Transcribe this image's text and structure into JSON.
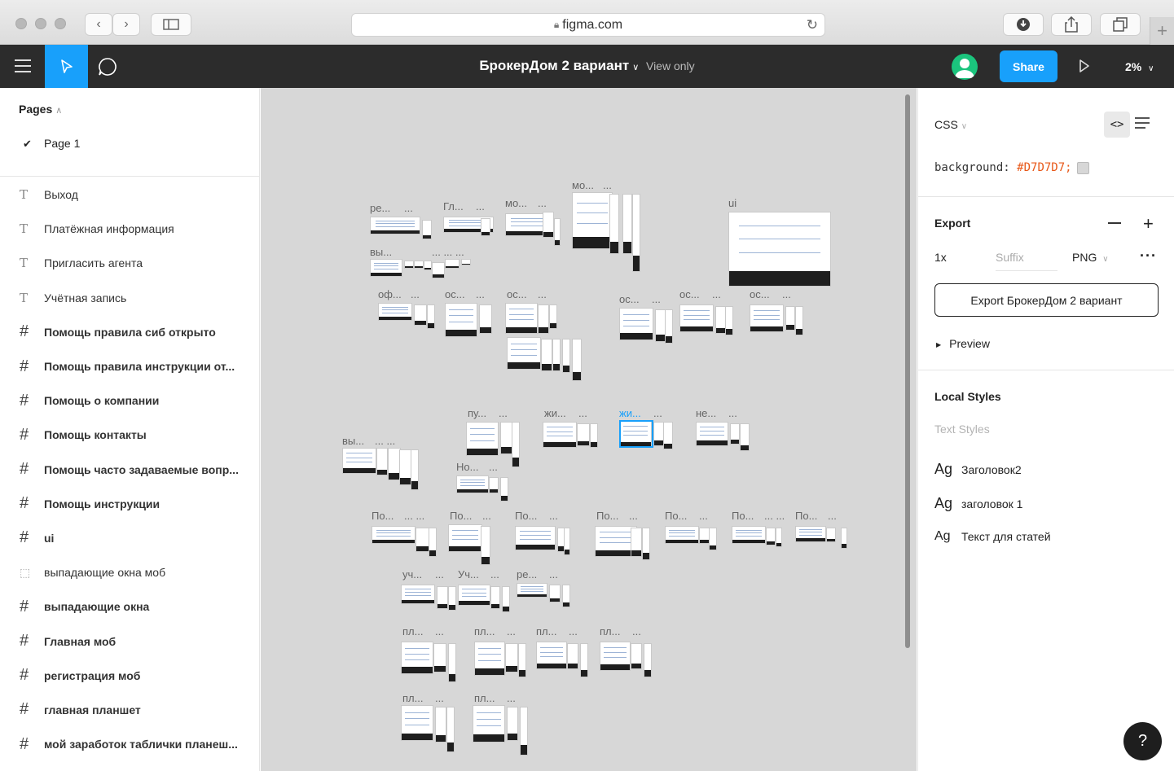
{
  "browser": {
    "url": "figma.com"
  },
  "toolbar": {
    "file_name": "БрокерДом 2 вариант",
    "view_mode": "View only",
    "share_label": "Share",
    "zoom": "2%"
  },
  "pages": {
    "heading": "Pages",
    "current": "Page 1"
  },
  "layers": [
    {
      "icon": "text-icon",
      "name": "Выход"
    },
    {
      "icon": "text-icon",
      "name": "Платёжная информация"
    },
    {
      "icon": "text-icon",
      "name": "Пригласить агента"
    },
    {
      "icon": "text-icon",
      "name": "Учётная запись"
    },
    {
      "icon": "frame-icon",
      "name": "Помощь правила сиб открыто"
    },
    {
      "icon": "frame-icon",
      "name": "Помощь правила инструкции от..."
    },
    {
      "icon": "frame-icon",
      "name": "Помощь о компании"
    },
    {
      "icon": "frame-icon",
      "name": "Помощь контакты"
    },
    {
      "icon": "frame-icon",
      "name": "Помощь часто задаваемые вопр..."
    },
    {
      "icon": "frame-icon",
      "name": "Помощь инструкции"
    },
    {
      "icon": "frame-icon",
      "name": "ui"
    },
    {
      "icon": "group-icon",
      "name": "выпадающие окна моб"
    },
    {
      "icon": "frame-icon",
      "name": "выпадающие окна"
    },
    {
      "icon": "frame-icon",
      "name": "Главная моб"
    },
    {
      "icon": "frame-icon",
      "name": "регистрация моб"
    },
    {
      "icon": "frame-icon",
      "name": "главная планшет"
    },
    {
      "icon": "frame-icon",
      "name": "мой заработок таблички планеш..."
    }
  ],
  "canvas": {
    "background": "#D7D7D7",
    "labels": {
      "l1": "ре...",
      "l2": "Гл...",
      "l3": "мо...",
      "l4": "мо...",
      "l5": "ui",
      "l6": "вы...",
      "l7": "оф...",
      "l8": "ос...",
      "l9": "ос...",
      "l10": "ос...",
      "l11": "ос...",
      "l12": "ос...",
      "l13": "пу...",
      "l14": "жи...",
      "l15": "жи...",
      "l16": "не...",
      "l17": "вы...",
      "l18": "Но...",
      "l19": "По...",
      "l20": "По...",
      "l21": "По...",
      "l22": "По...",
      "l23": "По...",
      "l24": "По...",
      "l25": "По...",
      "l26": "уч...",
      "l27": "Уч...",
      "l28": "ре...",
      "l29": "пл...",
      "l30": "пл...",
      "l31": "пл...",
      "l32": "пл...",
      "l33": "пл...",
      "l34": "пл...",
      "dots": "...",
      "dots2": "... ...",
      "dots3": "... ... ..."
    }
  },
  "inspect": {
    "language": "CSS",
    "css_property": "background:",
    "css_value": "#D7D7D7;",
    "export_heading": "Export",
    "export_scale": "1x",
    "export_suffix_placeholder": "Suffix",
    "export_format": "PNG",
    "export_button": "Export БрокерДом 2 вариант",
    "preview_label": "Preview",
    "local_styles_heading": "Local Styles",
    "text_styles_label": "Text Styles",
    "styles": [
      {
        "sample": "Ag",
        "name": "Заголовок2"
      },
      {
        "sample": "Ag",
        "name": "заголовок 1"
      },
      {
        "sample": "Ag",
        "name": "Текст для статей"
      }
    ]
  },
  "help_label": "?",
  "colors": {
    "accent": "#18A0FB",
    "toolbar": "#2C2C2C",
    "avatar": "#1BC47D"
  }
}
